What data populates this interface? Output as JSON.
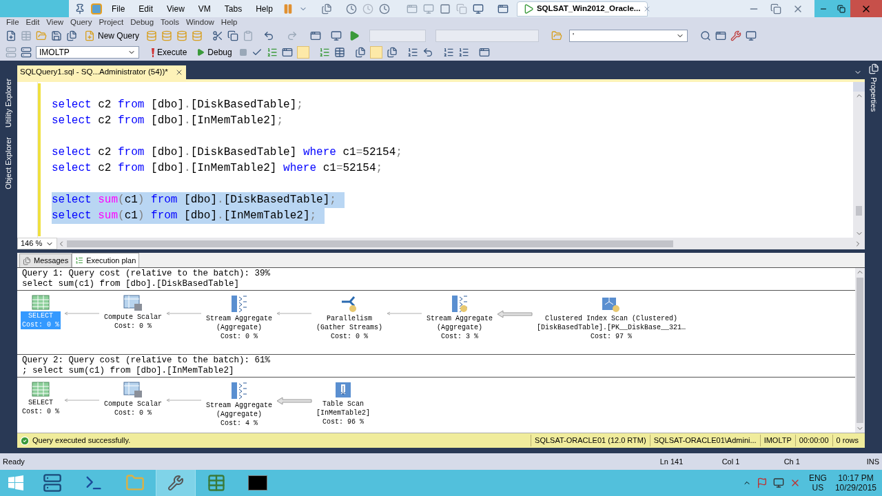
{
  "vm_bar": {
    "menus": [
      "File",
      "Edit",
      "View",
      "VM",
      "Tabs",
      "Help"
    ],
    "tab": "SQLSAT_Win2012_Oracle..."
  },
  "menu_bar": [
    "File",
    "Edit",
    "View",
    "Query",
    "Project",
    "Debug",
    "Tools",
    "Window",
    "Help"
  ],
  "toolbar1": {
    "new_query": "New Query",
    "search_value": "'"
  },
  "toolbar2": {
    "database": "IMOLTP",
    "execute": "Execute",
    "debug": "Debug"
  },
  "side_left": [
    "Utility Explorer",
    "Object Explorer"
  ],
  "side_right": [
    "Properties"
  ],
  "document_tab": "SQLQuery1.sql - SQ...Administrator (54))*",
  "editor": {
    "zoom": "146 %",
    "blocks": [
      {
        "selected": false,
        "lines": [
          [
            {
              "kind": "kw",
              "text": "select"
            },
            {
              "kind": "id",
              "text": " c2 "
            },
            {
              "kind": "kw",
              "text": "from"
            },
            {
              "kind": "id",
              "text": " [dbo]"
            },
            {
              "kind": "op",
              "text": "."
            },
            {
              "kind": "id",
              "text": "[DiskBasedTable]"
            },
            {
              "kind": "op",
              "text": ";"
            }
          ],
          [
            {
              "kind": "kw",
              "text": "select"
            },
            {
              "kind": "id",
              "text": " c2 "
            },
            {
              "kind": "kw",
              "text": "from"
            },
            {
              "kind": "id",
              "text": " [dbo]"
            },
            {
              "kind": "op",
              "text": "."
            },
            {
              "kind": "id",
              "text": "[InMemTable2]"
            },
            {
              "kind": "op",
              "text": ";"
            }
          ]
        ]
      },
      {
        "selected": false,
        "lines": [
          [
            {
              "kind": "kw",
              "text": "select"
            },
            {
              "kind": "id",
              "text": " c2 "
            },
            {
              "kind": "kw",
              "text": "from"
            },
            {
              "kind": "id",
              "text": " [dbo]"
            },
            {
              "kind": "op",
              "text": "."
            },
            {
              "kind": "id",
              "text": "[DiskBasedTable] "
            },
            {
              "kind": "kw",
              "text": "where"
            },
            {
              "kind": "id",
              "text": " c1"
            },
            {
              "kind": "op",
              "text": "="
            },
            {
              "kind": "id",
              "text": "52154"
            },
            {
              "kind": "op",
              "text": ";"
            }
          ],
          [
            {
              "kind": "kw",
              "text": "select"
            },
            {
              "kind": "id",
              "text": " c2 "
            },
            {
              "kind": "kw",
              "text": "from"
            },
            {
              "kind": "id",
              "text": " [dbo]"
            },
            {
              "kind": "op",
              "text": "."
            },
            {
              "kind": "id",
              "text": "[InMemTable2] "
            },
            {
              "kind": "kw",
              "text": "where"
            },
            {
              "kind": "id",
              "text": " c1"
            },
            {
              "kind": "op",
              "text": "="
            },
            {
              "kind": "id",
              "text": "52154"
            },
            {
              "kind": "op",
              "text": ";"
            }
          ]
        ]
      },
      {
        "selected": true,
        "lines": [
          [
            {
              "kind": "kw",
              "text": "select "
            },
            {
              "kind": "fn",
              "text": "sum"
            },
            {
              "kind": "op",
              "text": "("
            },
            {
              "kind": "id",
              "text": "c1"
            },
            {
              "kind": "op",
              "text": ") "
            },
            {
              "kind": "kw",
              "text": "from"
            },
            {
              "kind": "id",
              "text": " [dbo]"
            },
            {
              "kind": "op",
              "text": "."
            },
            {
              "kind": "id",
              "text": "[DiskBasedTable]"
            },
            {
              "kind": "op",
              "text": ";"
            }
          ],
          [
            {
              "kind": "kw",
              "text": "select "
            },
            {
              "kind": "fn",
              "text": "sum"
            },
            {
              "kind": "op",
              "text": "("
            },
            {
              "kind": "id",
              "text": "c1"
            },
            {
              "kind": "op",
              "text": ") "
            },
            {
              "kind": "kw",
              "text": "from"
            },
            {
              "kind": "id",
              "text": " [dbo]"
            },
            {
              "kind": "op",
              "text": "."
            },
            {
              "kind": "id",
              "text": "[InMemTable2]"
            },
            {
              "kind": "op",
              "text": ";"
            }
          ]
        ]
      }
    ]
  },
  "result_tabs": [
    {
      "label": "Messages",
      "selected": false
    },
    {
      "label": "Execution plan",
      "selected": true
    }
  ],
  "plans": [
    {
      "header": "Query 1: Query cost (relative to the batch): 39%",
      "query": "select sum(c1) from [dbo].[DiskBasedTable]",
      "nodes": [
        {
          "kind": "select",
          "lines": [
            "SELECT"
          ],
          "cost": "Cost: 0 %",
          "selected": true,
          "thick_arrow": false
        },
        {
          "kind": "compute",
          "lines": [
            "Compute Scalar"
          ],
          "cost": "Cost: 0 %",
          "selected": false,
          "thick_arrow": false
        },
        {
          "kind": "aggregate",
          "lines": [
            "Stream Aggregate",
            "(Aggregate)"
          ],
          "cost": "Cost: 0 %",
          "selected": false,
          "thick_arrow": false
        },
        {
          "kind": "parallelism",
          "lines": [
            "Parallelism",
            "(Gather Streams)"
          ],
          "cost": "Cost: 0 %",
          "selected": false,
          "thick_arrow": false
        },
        {
          "kind": "aggregate_parallel",
          "lines": [
            "Stream Aggregate",
            "(Aggregate)"
          ],
          "cost": "Cost: 3 %",
          "selected": false,
          "thick_arrow": true
        },
        {
          "kind": "index_scan",
          "lines": [
            "Clustered Index Scan (Clustered)",
            "[DiskBasedTable].[PK__DiskBase__321…"
          ],
          "cost": "Cost: 97 %",
          "selected": false
        }
      ]
    },
    {
      "header": "Query 2: Query cost (relative to the batch): 61%",
      "query": "; select sum(c1) from [dbo].[InMemTable2]",
      "nodes": [
        {
          "kind": "select",
          "lines": [
            "SELECT"
          ],
          "cost": "Cost: 0 %",
          "selected": false,
          "thick_arrow": false
        },
        {
          "kind": "compute",
          "lines": [
            "Compute Scalar"
          ],
          "cost": "Cost: 0 %",
          "selected": false,
          "thick_arrow": false
        },
        {
          "kind": "aggregate",
          "lines": [
            "Stream Aggregate",
            "(Aggregate)"
          ],
          "cost": "Cost: 4 %",
          "selected": false,
          "thick_arrow": true
        },
        {
          "kind": "table_scan",
          "lines": [
            "Table Scan",
            "[InMemTable2]"
          ],
          "cost": "Cost: 96 %",
          "selected": false
        }
      ]
    }
  ],
  "query_status": {
    "message": "Query executed successfully.",
    "cells": [
      "SQLSAT-ORACLE01 (12.0 RTM)",
      "SQLSAT-ORACLE01\\Admini...",
      "IMOLTP",
      "00:00:00",
      "0 rows"
    ]
  },
  "status_bar": {
    "left": "Ready",
    "cells": [
      "Ln 141",
      "Col 1",
      "Ch 1",
      "INS"
    ]
  },
  "taskbar": {
    "language": [
      "ENG",
      "US"
    ],
    "time": "10:17 PM",
    "date": "10/29/2015"
  }
}
